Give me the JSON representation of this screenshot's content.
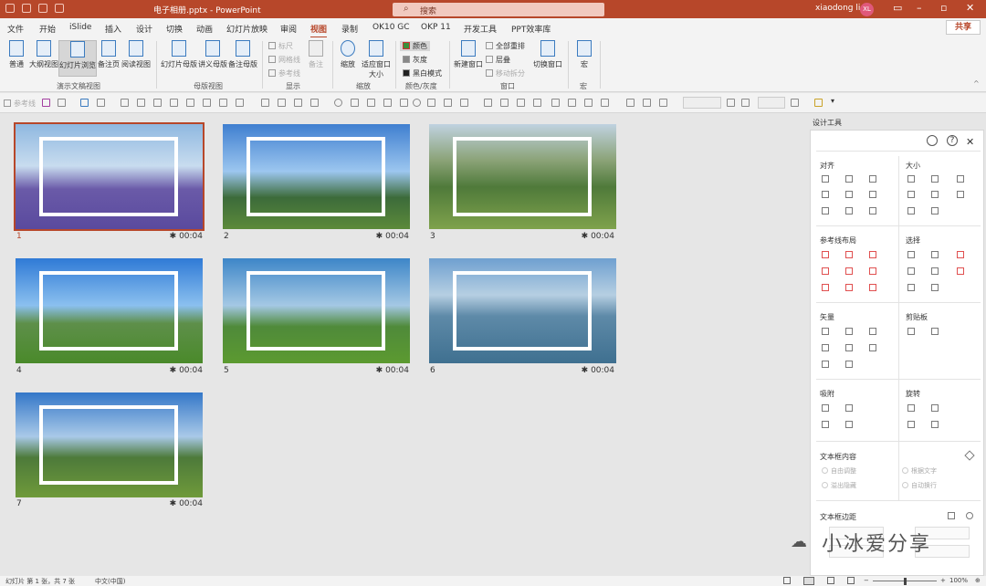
{
  "title_bar": {
    "title": "电子相册.pptx  -  PowerPoint",
    "search_placeholder": "搜索",
    "user_name": "xiaodong li",
    "avatar_initials": "XL"
  },
  "menu_tabs": [
    "文件",
    "开始",
    "iSlide",
    "插入",
    "设计",
    "切换",
    "动画",
    "幻灯片放映",
    "审阅",
    "视图",
    "录制",
    "OK10 GC",
    "OKP 11",
    "开发工具",
    "PPT效率库"
  ],
  "active_tab": "视图",
  "share_label": "共享",
  "ribbon": {
    "groups": {
      "presentation_views": {
        "label": "演示文稿视图",
        "buttons": [
          "普通",
          "大纲视图",
          "幻灯片浏览",
          "备注页",
          "阅读视图"
        ]
      },
      "master_views": {
        "label": "母版视图",
        "buttons": [
          "幻灯片母版",
          "讲义母版",
          "备注母版"
        ]
      },
      "show": {
        "label": "显示",
        "items": [
          "标尺",
          "网格线",
          "参考线"
        ],
        "notes": "备注"
      },
      "zoom": {
        "label": "缩放",
        "buttons": [
          "缩放",
          "适应窗口大小"
        ]
      },
      "color": {
        "label": "颜色/灰度",
        "items": [
          "颜色",
          "灰度",
          "黑白模式"
        ]
      },
      "window": {
        "label": "窗口",
        "new_window": "新建窗口",
        "items": [
          "全部重排",
          "层叠",
          "移动拆分"
        ],
        "switch_window": "切换窗口"
      },
      "macro": {
        "label": "宏",
        "button": "宏"
      }
    }
  },
  "toolbar2": {
    "guide_label": "参考线"
  },
  "slides": [
    {
      "num": "1",
      "time": "00:04"
    },
    {
      "num": "2",
      "time": "00:04"
    },
    {
      "num": "3",
      "time": "00:04"
    },
    {
      "num": "4",
      "time": "00:04"
    },
    {
      "num": "5",
      "time": "00:04"
    },
    {
      "num": "6",
      "time": "00:04"
    },
    {
      "num": "7",
      "time": "00:04"
    }
  ],
  "panel": {
    "title": "设计工具",
    "sections": {
      "align": "对齐",
      "size": "大小",
      "guide_layout": "参考线布局",
      "select": "选择",
      "vector": "矢量",
      "clipboard": "剪贴板",
      "snap": "吸附",
      "rotate": "旋转",
      "text_content": "文本框内容",
      "text_margin": "文本框边距"
    },
    "text_options": [
      "自由调整",
      "根据文字",
      "溢出隐藏",
      "自动换行"
    ]
  },
  "watermark": "小冰爱分享",
  "status_bar": {
    "slide_info": "幻灯片 第 1 张，共 7 张",
    "language": "中文(中国)",
    "zoom": "100%"
  }
}
